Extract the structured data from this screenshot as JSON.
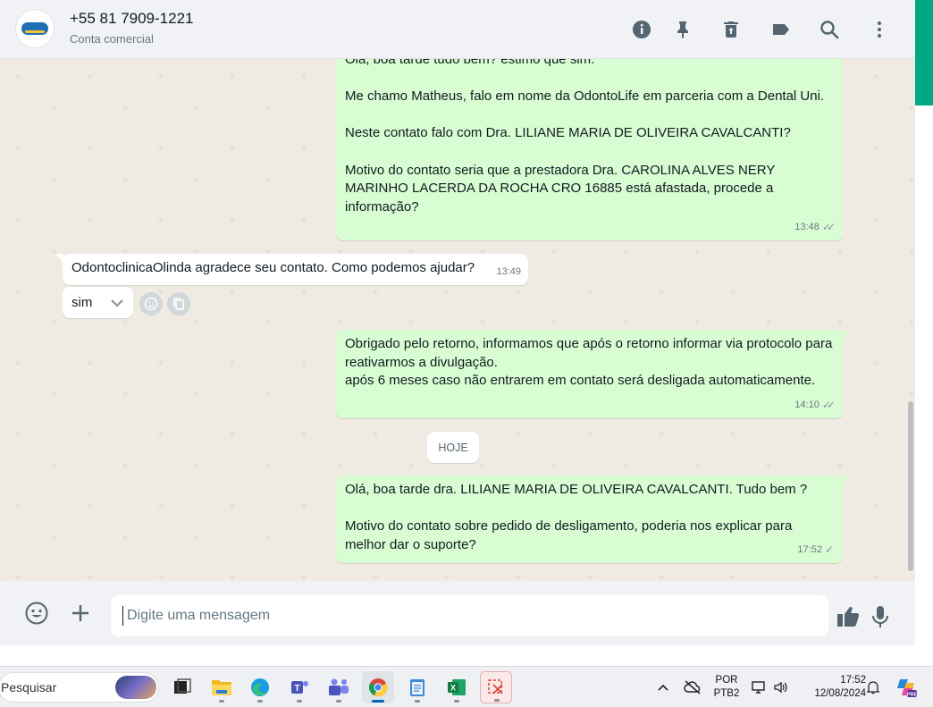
{
  "header": {
    "contact_name": "+55 81 7909-1221",
    "contact_subtitle": "Conta comercial",
    "icons": [
      "info-icon",
      "pin-icon",
      "delete-icon",
      "label-icon",
      "search-icon",
      "menu-icon"
    ]
  },
  "messages": [
    {
      "direction": "out",
      "text": "Olá, boa tarde tudo bem? estimo que sim.\n\nMe chamo Matheus, falo em nome da OdontoLife em parceria com a Dental Uni.\n\nNeste contato falo com Dra. LILIANE MARIA DE OLIVEIRA CAVALCANTI?\n\nMotivo do contato seria que a prestadora Dra. CAROLINA ALVES NERY MARINHO LACERDA DA ROCHA CRO 16885 está afastada, procede a informação?",
      "time": "13:48",
      "status": "read"
    },
    {
      "direction": "in",
      "text": "OdontoclinicaOlinda agradece seu contato. Como podemos ajudar?",
      "time": "13:49"
    },
    {
      "direction": "out",
      "text": "Obrigado pelo retorno, informamos que após o retorno informar via protocolo para reativarmos a divulgação.\napós 6 meses caso não entrarem em contato será desligada automaticamente.",
      "time": "14:10",
      "status": "read"
    },
    {
      "direction": "out",
      "text": "Olá, boa tarde dra. LILIANE MARIA DE OLIVEIRA CAVALCANTI. Tudo bem ?\n\nMotivo do contato sobre pedido de desligamento, poderia nos explicar para melhor dar o suporte?",
      "time": "17:52",
      "status": "sent"
    }
  ],
  "reply_chip": {
    "label": "sim"
  },
  "date_divider": "HOJE",
  "composer": {
    "placeholder": "Digite uma mensagem"
  },
  "taskbar": {
    "search_placeholder": "Pesquisar",
    "lang_top": "POR",
    "lang_bottom": "PTB2",
    "time": "17:52",
    "date": "12/08/2024",
    "apps": [
      "task-view",
      "file-explorer",
      "edge",
      "teams-classic",
      "teams",
      "chrome",
      "notepad",
      "excel",
      "snipping-tool"
    ]
  },
  "colors": {
    "outgoing_bubble": "#d9fdd3",
    "incoming_bubble": "#ffffff",
    "chat_background": "#efeae2",
    "accent": "#00a884"
  }
}
